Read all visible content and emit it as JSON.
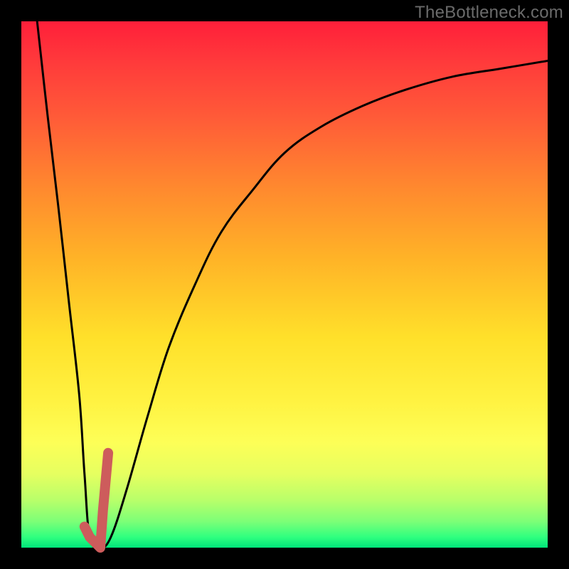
{
  "watermark": "TheBottleneck.com",
  "colors": {
    "gradient_top": "#ff1f3a",
    "gradient_bottom": "#00e57a",
    "curve": "#000000",
    "highlight": "#cd5c5c",
    "frame": "#000000"
  },
  "chart_data": {
    "type": "line",
    "title": "",
    "xlabel": "",
    "ylabel": "",
    "xlim": [
      0,
      100
    ],
    "ylim": [
      0,
      100
    ],
    "grid": false,
    "legend": false,
    "series": [
      {
        "name": "bottleneck-curve",
        "x": [
          3,
          5,
          7,
          9,
          11,
          12,
          13,
          15,
          17,
          20,
          24,
          28,
          33,
          38,
          44,
          50,
          57,
          65,
          73,
          82,
          91,
          100
        ],
        "y": [
          100,
          82,
          65,
          47,
          29,
          14,
          2,
          0,
          2,
          11,
          25,
          38,
          50,
          60,
          68,
          75,
          80,
          84,
          87,
          89.5,
          91,
          92.5
        ]
      },
      {
        "name": "highlight-segment",
        "x": [
          12,
          13,
          15,
          15.5,
          16.5
        ],
        "y": [
          4,
          2,
          0,
          7,
          18
        ]
      }
    ],
    "annotations": [
      {
        "text": "TheBottleneck.com",
        "position": "top-right"
      }
    ]
  }
}
